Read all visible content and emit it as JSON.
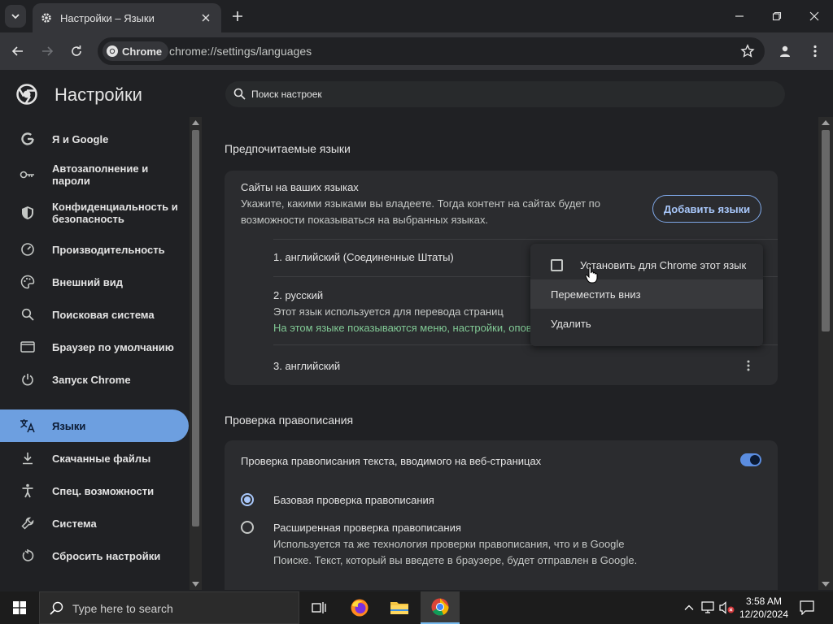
{
  "window": {
    "tab_title": "Настройки – Языки"
  },
  "toolbar": {
    "chip_label": "Chrome",
    "url": "chrome://settings/languages"
  },
  "header": {
    "title": "Настройки",
    "search_placeholder": "Поиск настроек"
  },
  "sidebar": {
    "items": [
      {
        "label": "Я и Google",
        "icon": "google-g-icon"
      },
      {
        "label": "Автозаполнение и пароли",
        "icon": "key-icon"
      },
      {
        "label": "Конфиденциальность и безопасность",
        "icon": "shield-icon"
      },
      {
        "label": "Производительность",
        "icon": "speedometer-icon"
      },
      {
        "label": "Внешний вид",
        "icon": "palette-icon"
      },
      {
        "label": "Поисковая система",
        "icon": "search-icon"
      },
      {
        "label": "Браузер по умолчанию",
        "icon": "browser-window-icon"
      },
      {
        "label": "Запуск Chrome",
        "icon": "power-icon"
      },
      {
        "label": "Языки",
        "icon": "translate-icon"
      },
      {
        "label": "Скачанные файлы",
        "icon": "download-icon"
      },
      {
        "label": "Спец. возможности",
        "icon": "accessibility-icon"
      },
      {
        "label": "Система",
        "icon": "wrench-icon"
      },
      {
        "label": "Сбросить настройки",
        "icon": "reset-icon"
      }
    ],
    "active_index": 8
  },
  "languages_section": {
    "title": "Предпочитаемые языки",
    "card_title": "Сайты на ваших языках",
    "card_desc_line1": "Укажите, какими языками вы владеете. Тогда контент на сайтах будет по",
    "card_desc_line2": "возможности показываться на выбранных языках.",
    "add_button": "Добавить языки",
    "languages": [
      {
        "name": "1. английский (Соединенные Штаты)"
      },
      {
        "name": "2. русский",
        "note1": "Этот язык используется для перевода страниц",
        "note2": "На этом языке показываются меню, настройки, оповещения"
      },
      {
        "name": "3. английский"
      }
    ]
  },
  "context_menu": {
    "items": [
      {
        "label": "Установить для Chrome этот язык",
        "checked": false
      },
      {
        "label": "Переместить вниз"
      },
      {
        "label": "Удалить"
      }
    ]
  },
  "spellcheck_section": {
    "title": "Проверка правописания",
    "toggle_label": "Проверка правописания текста, вводимого на веб-страницах",
    "toggle_on": true,
    "basic_label": "Базовая проверка правописания",
    "enhanced_label": "Расширенная проверка правописания",
    "enhanced_desc_line1": "Используется та же технология проверки правописания, что и в Google",
    "enhanced_desc_line2": "Поиске. Текст, который вы введете в браузере, будет отправлен в Google.",
    "selected": "basic"
  },
  "taskbar": {
    "search_placeholder": "Type here to search",
    "time": "3:58 AM",
    "date": "12/20/2024"
  },
  "colors": {
    "accent": "#6d9fe0",
    "link_blue": "#a8c7fa",
    "green_note": "#81c995"
  }
}
